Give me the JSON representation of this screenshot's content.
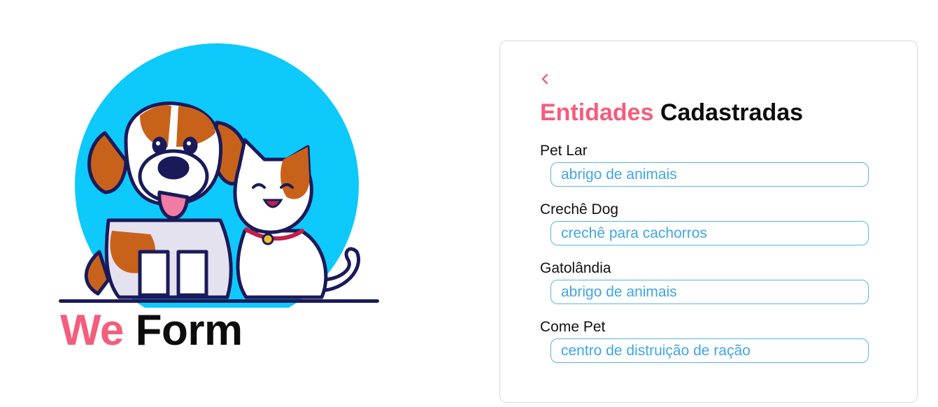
{
  "brand": {
    "title_accent": "We",
    "title_rest": "Form",
    "illustration": "dog-and-cat-illustration"
  },
  "card": {
    "back_icon": "chevron-left-icon",
    "title_accent": "Entidades",
    "title_rest": "Cadastradas",
    "entities": [
      {
        "name": "Pet Lar",
        "description": "abrigo de animais"
      },
      {
        "name": "Crechê Dog",
        "description": "crechê para cachorros"
      },
      {
        "name": "Gatolândia",
        "description": "abrigo de animais"
      },
      {
        "name": "Come Pet",
        "description": "centro de distruição de ração"
      }
    ]
  },
  "colors": {
    "accent": "#f45d7c",
    "field_border": "#5ab4e8",
    "field_text": "#3fa6e3",
    "circle": "#0ec9fb"
  }
}
